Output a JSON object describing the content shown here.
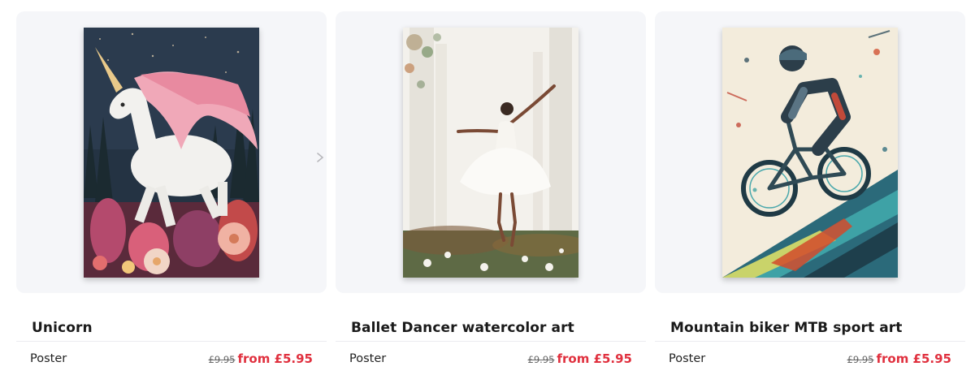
{
  "products": [
    {
      "name": "Unicorn",
      "format": "Poster",
      "old_price": "£9.95",
      "price": "from £5.95"
    },
    {
      "name": "Ballet Dancer watercolor art",
      "format": "Poster",
      "old_price": "£9.95",
      "price": "from £5.95"
    },
    {
      "name": "Mountain biker MTB sport art",
      "format": "Poster",
      "old_price": "£9.95",
      "price": "from £5.95"
    }
  ],
  "icons": {
    "next": "chevron-right-icon"
  },
  "colors": {
    "card_bg": "#f5f6f9",
    "sale_price": "#e0303e",
    "title_text": "#1a1a1a"
  }
}
